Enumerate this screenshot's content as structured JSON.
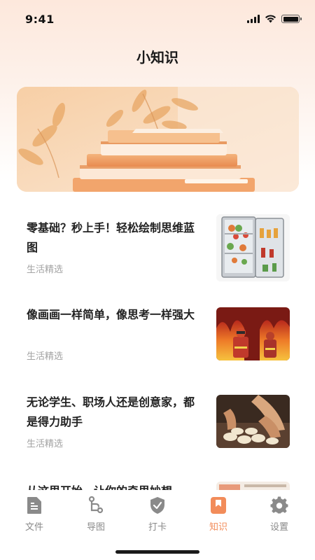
{
  "status_bar": {
    "time": "9:41"
  },
  "header": {
    "title": "小知识"
  },
  "articles": [
    {
      "title": "零基础？秒上手！轻松绘制思维蓝图",
      "source": "生活精选",
      "thumb": "fridge-image"
    },
    {
      "title": "像画画一样简单，像思考一样强大",
      "source": "生活精选",
      "thumb": "firefighters-image"
    },
    {
      "title": "无论学生、职场人还是创意家，都是得力助手",
      "source": "生活精选",
      "thumb": "dumplings-image"
    },
    {
      "title": "从这里开始，让你的奇思妙想",
      "source": "",
      "thumb": "partial-image"
    }
  ],
  "tabs": [
    {
      "label": "文件",
      "icon": "file-icon",
      "active": false
    },
    {
      "label": "导图",
      "icon": "mindmap-icon",
      "active": false
    },
    {
      "label": "打卡",
      "icon": "checkin-icon",
      "active": false
    },
    {
      "label": "知识",
      "icon": "bookmark-icon",
      "active": true
    },
    {
      "label": "设置",
      "icon": "gear-icon",
      "active": false
    }
  ],
  "colors": {
    "accent": "#f28c5a",
    "inactive": "#8a8a8a"
  }
}
